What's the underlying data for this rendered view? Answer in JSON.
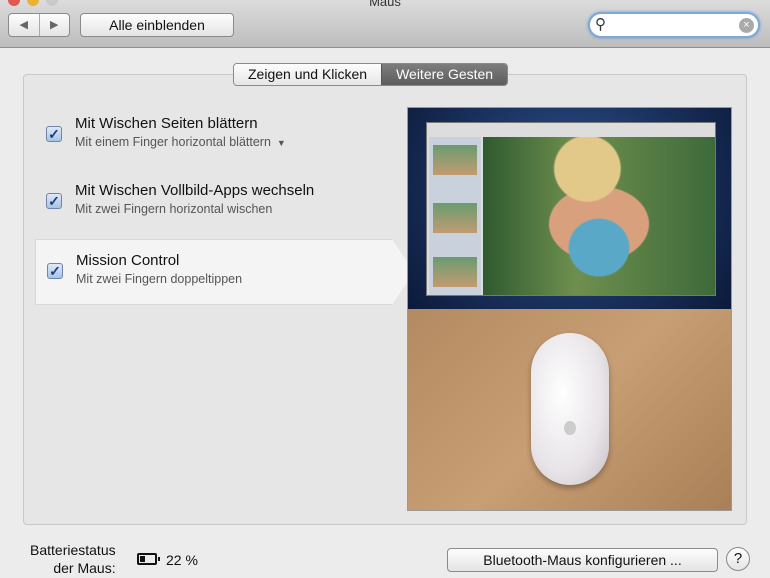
{
  "window": {
    "title": "Maus"
  },
  "toolbar": {
    "back": "◀",
    "forward": "▶",
    "show_all": "Alle einblenden",
    "search_placeholder": "",
    "search_icon": "magnifier-icon",
    "clear_icon": "clear-icon"
  },
  "tabs": [
    {
      "label": "Zeigen und Klicken",
      "selected": false
    },
    {
      "label": "Weitere Gesten",
      "selected": true
    }
  ],
  "gestures": [
    {
      "label": "Mit Wischen Seiten blättern",
      "sub": "Mit einem Finger horizontal blättern",
      "has_dropdown": true,
      "checked": true
    },
    {
      "label": "Mit Wischen Vollbild-Apps wechseln",
      "sub": "Mit zwei Fingern horizontal wischen",
      "checked": true
    },
    {
      "label": "Mission Control",
      "sub": "Mit zwei Fingern doppeltippen",
      "checked": true,
      "selected": true
    }
  ],
  "footer": {
    "battery_label_1": "Batteriestatus",
    "battery_label_2": "der Maus:",
    "battery_value": "22 %",
    "configure": "Bluetooth-Maus konfigurieren ...",
    "help": "?"
  }
}
